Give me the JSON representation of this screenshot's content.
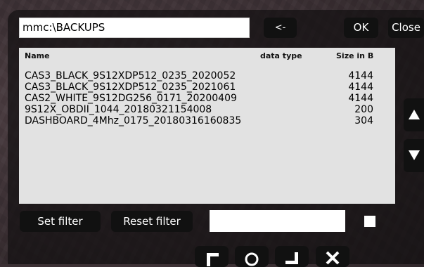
{
  "header": {
    "path_value": "mmc:\\BACKUPS",
    "back_label": "<-",
    "ok_label": "OK",
    "close_label": "Close"
  },
  "file_list": {
    "columns": {
      "name": "Name",
      "data_type": "data type",
      "size": "Size in B"
    },
    "rows": [
      {
        "name": "CAS3_BLACK_9S12XDP512_0235_2020052",
        "size": "4144"
      },
      {
        "name": "CAS3_BLACK_9S12XDP512_0235_2021061",
        "size": "4144"
      },
      {
        "name": "CAS2_WHITE_9S12DG256_0171_20200409",
        "size": "4144"
      },
      {
        "name": "9S12X_OBDII_1044_20180321154008",
        "size": "200"
      },
      {
        "name": "DASHBOARD_4Mhz_0175_20180316160835",
        "size": "304"
      }
    ]
  },
  "scroll": {
    "up_icon": "triangle-up-icon",
    "down_icon": "triangle-down-icon"
  },
  "filter": {
    "set_label": "Set filter",
    "reset_label": "Reset filter",
    "input_value": "",
    "checkbox_checked": false
  },
  "bottom_buttons": [
    {
      "icon": "corner-top-left-icon"
    },
    {
      "icon": "circle-icon"
    },
    {
      "icon": "corner-bottom-right-icon"
    },
    {
      "icon": "x-icon"
    }
  ],
  "colors": {
    "button_bg": "#111111",
    "list_bg": "#e2e2e2",
    "panel_bg": "#2c2427"
  }
}
